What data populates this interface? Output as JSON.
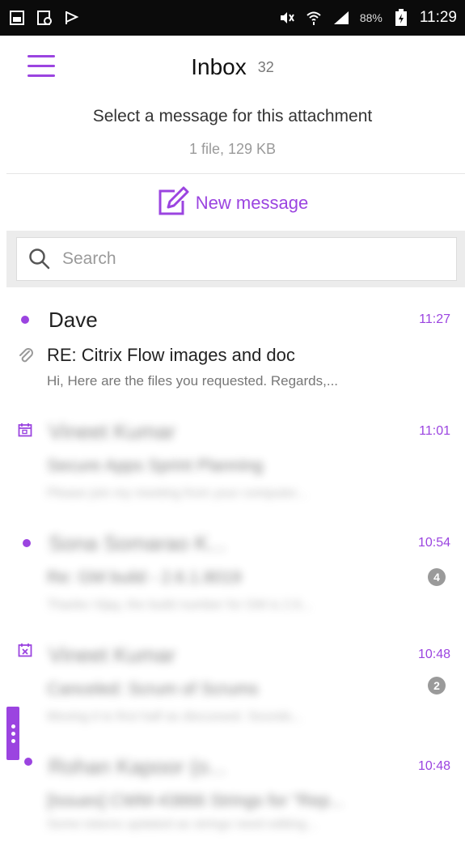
{
  "status_bar": {
    "battery_percent": "88%",
    "time": "11:29",
    "icons": [
      "gallery-icon",
      "photo-sync-icon",
      "flag-icon",
      "mute-icon",
      "wifi-icon",
      "signal-icon",
      "battery-icon"
    ]
  },
  "header": {
    "title": "Inbox",
    "count": "32"
  },
  "attachment": {
    "prompt": "Select a message for this attachment",
    "details": "1 file, 129 KB"
  },
  "actions": {
    "new_message_label": "New message"
  },
  "search": {
    "placeholder": "Search"
  },
  "emails": [
    {
      "sender": "Dave",
      "time": "11:27",
      "subject": "RE: Citrix Flow images and doc",
      "preview": "Hi, Here are the files you requested. Regards,...",
      "unread": true,
      "has_attachment": true
    },
    {
      "sender": "Vineet Kumar",
      "time": "11:01",
      "subject": "Secure Apps Sprint Planning",
      "preview": "Please join my meeting from your computer...",
      "indicator": "calendar-icon"
    },
    {
      "sender": "Sona Somarao K...",
      "time": "10:54",
      "subject": "Re: GM build - 2.6.1.8019",
      "preview": "Thanks Vijay, the build number for GM is 2.6...",
      "unread": true,
      "thread_count": "4"
    },
    {
      "sender": "Vineet Kumar",
      "time": "10:48",
      "subject": "Canceled: Scrum of Scrums",
      "preview": "Moving it to first half as discussed. Sounds...",
      "indicator": "calendar-cancel-icon",
      "thread_count": "2"
    },
    {
      "sender": "Rohan Kapoor (o...",
      "time": "10:48",
      "subject": "[Issues] CWM-43866 Strings for \"Rep...",
      "preview": "Some tokens updated as strings need editing...",
      "unread": true
    }
  ],
  "colors": {
    "accent": "#9b44e0",
    "status_bar": "#0b0b0b",
    "badge": "#9a9a9a"
  }
}
